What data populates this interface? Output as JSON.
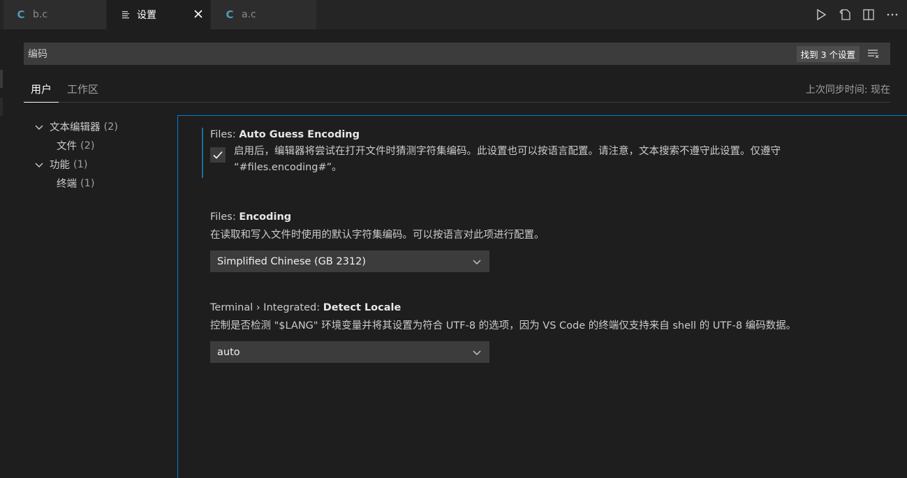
{
  "tabs": [
    {
      "icon": "C",
      "label": "b.c",
      "active": false
    },
    {
      "icon": "settings-lines",
      "label": "设置",
      "active": true
    },
    {
      "icon": "C",
      "label": "a.c",
      "active": false
    }
  ],
  "search": {
    "value": "编码",
    "result_count": "找到 3 个设置"
  },
  "scope": {
    "user_label": "用户",
    "workspace_label": "工作区",
    "sync_label": "上次同步时间: 现在"
  },
  "toc": [
    {
      "label": "文本编辑器",
      "count": "(2)",
      "expanded": true
    },
    {
      "label": "文件",
      "count": "(2)",
      "child": true
    },
    {
      "label": "功能",
      "count": "(1)",
      "expanded": true
    },
    {
      "label": "终端",
      "count": "(1)",
      "child": true
    }
  ],
  "settings": [
    {
      "category": "Files: ",
      "name": "Auto Guess Encoding",
      "description_line1": "启用后，编辑器将尝试在打开文件时猜测字符集编码。此设置也可以按语言配置。请注意，文本搜索不遵守此设置。仅遵守",
      "description_line2": "“#files.encoding#”。",
      "checked": true
    },
    {
      "category": "Files: ",
      "name": "Encoding",
      "description": "在读取和写入文件时使用的默认字符集编码。可以按语言对此项进行配置。",
      "value": "Simplified Chinese (GB 2312)"
    },
    {
      "category": "Terminal › Integrated: ",
      "name": "Detect Locale",
      "description": "控制是否检测 \"$LANG\" 环境变量并将其设置为符合 UTF-8 的选项，因为 VS Code 的终端仅支持来自 shell 的 UTF-8 编码数据。",
      "value": "auto"
    }
  ],
  "colors": {
    "accent_focus": "#007fd4",
    "c_icon": "#519aba"
  }
}
